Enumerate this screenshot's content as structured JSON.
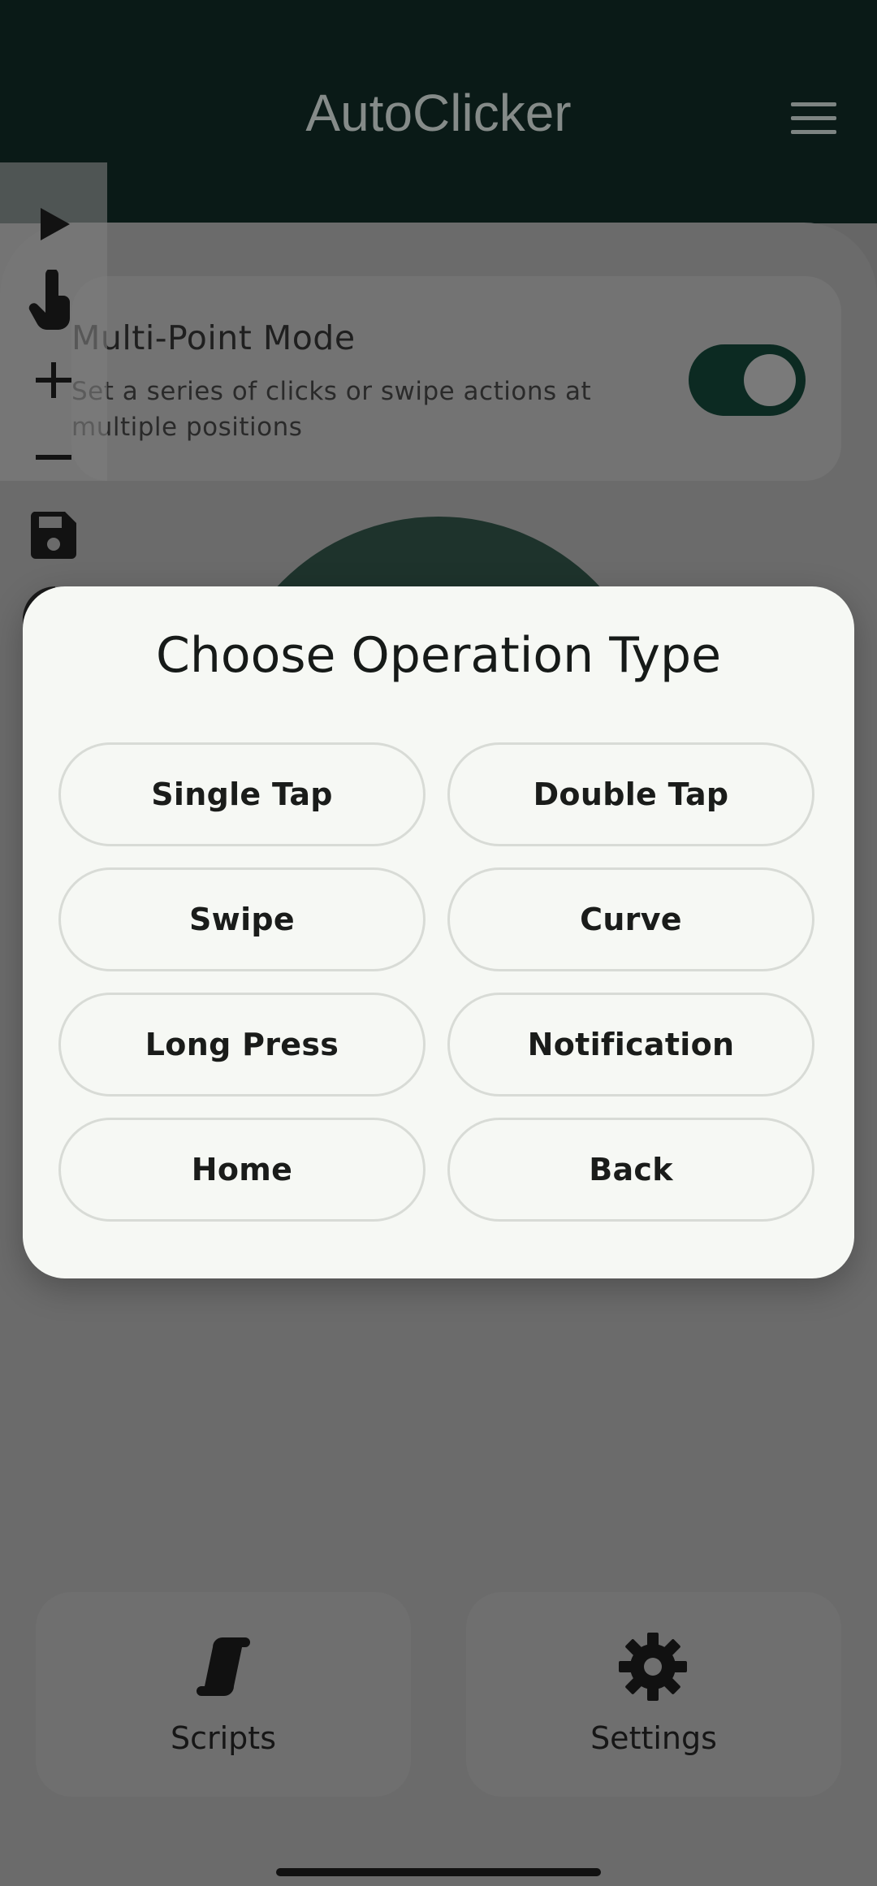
{
  "app_bar": {
    "title": "AutoClicker",
    "menu_icon": "hamburger-menu-icon"
  },
  "toolbar": {
    "icons": [
      "play-icon",
      "touch-icon",
      "plus-icon",
      "minus-icon",
      "save-icon"
    ]
  },
  "mode_card": {
    "title": "Multi-Point Mode",
    "description": "Set a series of clicks or swipe actions at multiple positions",
    "toggle_on": true
  },
  "bottom_nav": [
    {
      "label": "Scripts",
      "icon": "scroll-icon"
    },
    {
      "label": "Settings",
      "icon": "gear-icon"
    }
  ],
  "dialog": {
    "title": "Choose Operation Type",
    "options": [
      "Single Tap",
      "Double Tap",
      "Swipe",
      "Curve",
      "Long Press",
      "Notification",
      "Home",
      "Back"
    ]
  },
  "colors": {
    "app_bar_bg": "#0a1a17",
    "accent": "#0c2a22",
    "dialog_bg": "#f6f8f4",
    "scrim_bg": "#666666"
  }
}
